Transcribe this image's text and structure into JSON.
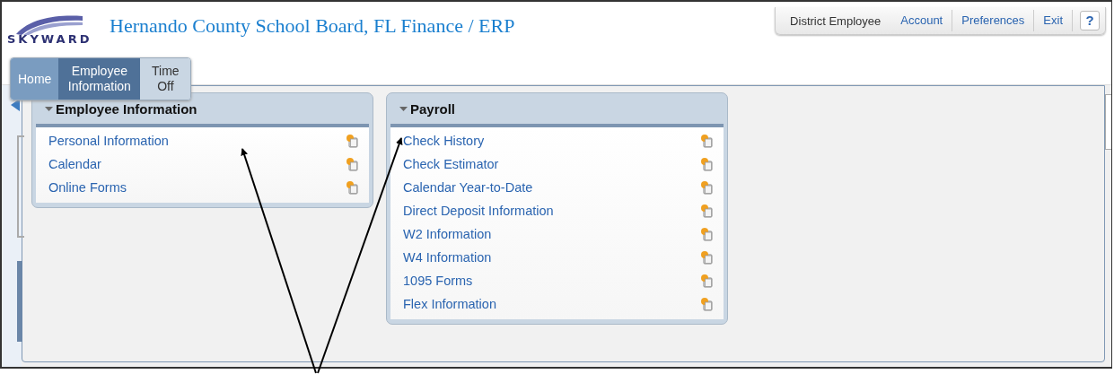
{
  "header": {
    "logo_text": "SKYWARD",
    "title": "Hernando County School Board, FL Finance / ERP"
  },
  "top_links": [
    {
      "label": "District Employee",
      "kind": "text"
    },
    {
      "label": "Account",
      "kind": "link"
    },
    {
      "label": "Preferences",
      "kind": "link"
    },
    {
      "label": "Exit",
      "kind": "link"
    },
    {
      "label": "?",
      "kind": "help"
    }
  ],
  "tabs": [
    {
      "label": "Home",
      "selected": false
    },
    {
      "label": "Employee Information",
      "selected": true
    },
    {
      "label": "Time Off",
      "selected": false
    }
  ],
  "cards": [
    {
      "title": "Employee Information",
      "expanded": true,
      "items": [
        "Personal Information",
        "Calendar",
        "Online Forms"
      ]
    },
    {
      "title": "Payroll",
      "expanded": true,
      "items": [
        "Check History",
        "Check Estimator",
        "Calendar Year-to-Date",
        "Direct Deposit Information",
        "W2 Information",
        "W4 Information",
        "1095 Forms",
        "Flex Information"
      ]
    }
  ]
}
